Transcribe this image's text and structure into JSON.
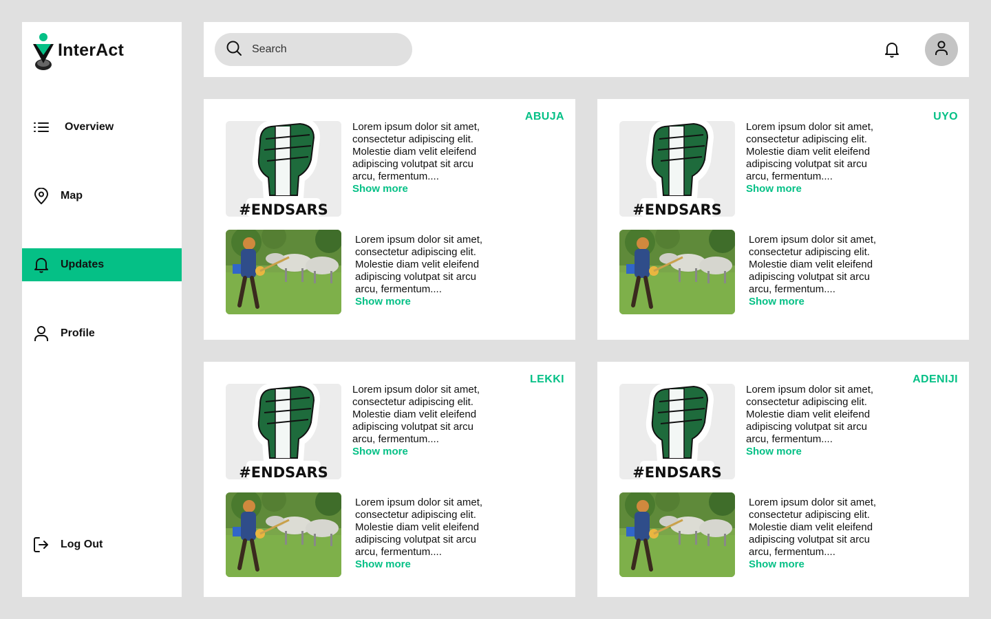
{
  "brand": {
    "name": "InterAct",
    "logo_icon": "person-pin-logo",
    "accent": "#05c086"
  },
  "sidebar": {
    "items": [
      {
        "label": "Overview",
        "icon": "list-icon"
      },
      {
        "label": "Map",
        "icon": "map-pin-icon"
      },
      {
        "label": "Updates",
        "icon": "bell-icon",
        "active": true
      },
      {
        "label": "Profile",
        "icon": "user-icon"
      }
    ],
    "logout": {
      "label": "Log Out",
      "icon": "logout-icon"
    }
  },
  "topbar": {
    "search_placeholder": "Search",
    "notification_icon": "bell-icon",
    "avatar_icon": "user-icon"
  },
  "cards": [
    {
      "location": "ABUJA",
      "posts": [
        {
          "image": "endsars-fist",
          "image_text": "#ENDSARS",
          "text": "Lorem ipsum dolor sit amet, consectetur adipiscing elit. Molestie diam velit eleifend adipiscing volutpat sit arcu arcu, fermentum....",
          "show_more": "Show more"
        },
        {
          "image": "herder-with-cattle",
          "text": "Lorem ipsum dolor sit amet, consectetur adipiscing elit. Molestie diam velit eleifend adipiscing volutpat sit arcu arcu, fermentum....",
          "show_more": "Show more"
        }
      ]
    },
    {
      "location": "UYO",
      "posts": [
        {
          "image": "endsars-fist",
          "image_text": "#ENDSARS",
          "text": "Lorem ipsum dolor sit amet, consectetur adipiscing elit. Molestie diam velit eleifend adipiscing volutpat sit arcu arcu, fermentum....",
          "show_more": "Show more"
        },
        {
          "image": "herder-with-cattle",
          "text": "Lorem ipsum dolor sit amet, consectetur adipiscing elit. Molestie diam velit eleifend adipiscing volutpat sit arcu arcu, fermentum....",
          "show_more": "Show more"
        }
      ]
    },
    {
      "location": "LEKKI",
      "posts": [
        {
          "image": "endsars-fist",
          "image_text": "#ENDSARS",
          "text": "Lorem ipsum dolor sit amet, consectetur adipiscing elit. Molestie diam velit eleifend adipiscing volutpat sit arcu arcu, fermentum....",
          "show_more": "Show more"
        },
        {
          "image": "herder-with-cattle",
          "text": "Lorem ipsum dolor sit amet, consectetur adipiscing elit. Molestie diam velit eleifend adipiscing volutpat sit arcu arcu, fermentum....",
          "show_more": "Show more"
        }
      ]
    },
    {
      "location": "ADENIJI",
      "posts": [
        {
          "image": "endsars-fist",
          "image_text": "#ENDSARS",
          "text": "Lorem ipsum dolor sit amet, consectetur adipiscing elit. Molestie diam velit eleifend adipiscing volutpat sit arcu arcu, fermentum....",
          "show_more": "Show more"
        },
        {
          "image": "herder-with-cattle",
          "text": "Lorem ipsum dolor sit amet, consectetur adipiscing elit. Molestie diam velit eleifend adipiscing volutpat sit arcu arcu, fermentum....",
          "show_more": "Show more"
        }
      ]
    }
  ]
}
